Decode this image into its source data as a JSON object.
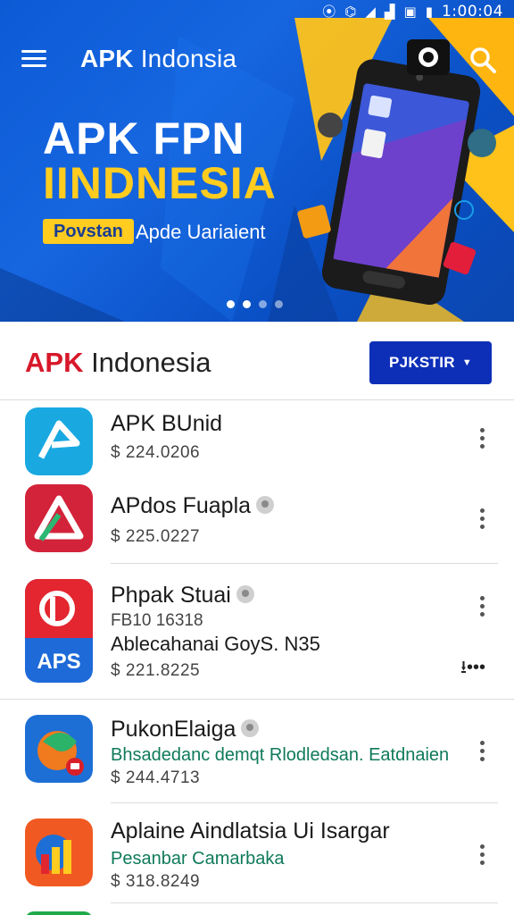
{
  "status_bar": {
    "time": "1:00:04",
    "icons": [
      "location-icon",
      "vibrate-icon",
      "wifi-icon",
      "signal-icon",
      "nfc-icon",
      "battery-icon"
    ]
  },
  "app_bar": {
    "title_bold": "APK",
    "title_rest": " Indonsia",
    "menu_icon": "hamburger-menu-icon",
    "search_icon": "search-icon"
  },
  "hero": {
    "headline_1": "APK FPN",
    "headline_2": "IINDNESIA",
    "badge": "Povstan",
    "subtitle": "Apde Uariaient",
    "slide_count": 4,
    "active_slide": 2,
    "colors": {
      "headline_accent": "#ffcc1f",
      "background": "#0d5ad6"
    }
  },
  "section": {
    "title_red": "APK",
    "title_rest": " Indonesia",
    "sort_button": "PJKSTIR",
    "sort_button_color": "#0d2fb8"
  },
  "apps": [
    {
      "name": "APK BUnid",
      "price": "$ 224.0206",
      "verified": false,
      "icon": "ad-arrow-icon"
    },
    {
      "name": "APdos Fuapla",
      "price": "$ 225.0227",
      "verified": true,
      "icon": "triangle-logo-icon"
    },
    {
      "name": "Phpak Stuai",
      "meta": "FB10 16318",
      "subtitle": "Ablecahanai GoyS. N35",
      "price": "$ 221.8225",
      "verified": true,
      "icon": "aps-red-icon",
      "icon_label": "APS",
      "action": "download-icon"
    },
    {
      "name": "PukonElaiga",
      "subtitle": "Bhsadedanc demqt Rlodledsan. Eatdnaien",
      "price": "$ 244.4713",
      "verified": true,
      "icon": "swirl-logo-icon"
    },
    {
      "name": "Aplaine Aindlatsia Ui Isargar",
      "subtitle": "Pesanbar Camarbaka",
      "price": "$ 318.8249",
      "verified": false,
      "icon": "chart-logo-icon"
    }
  ]
}
